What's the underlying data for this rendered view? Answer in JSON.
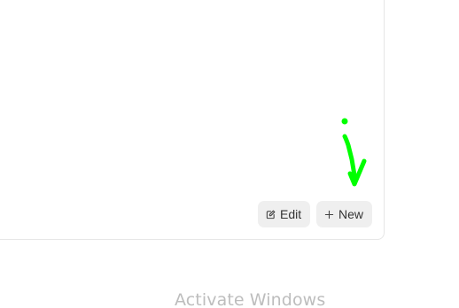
{
  "toolbar": {
    "edit_label": "Edit",
    "edit_icon": "edit-icon",
    "new_label": "New",
    "new_icon": "plus-icon"
  },
  "annotation": {
    "icon": "arrow-down-icon",
    "color": "#00ff00"
  },
  "watermark": {
    "text": "Activate Windows"
  }
}
